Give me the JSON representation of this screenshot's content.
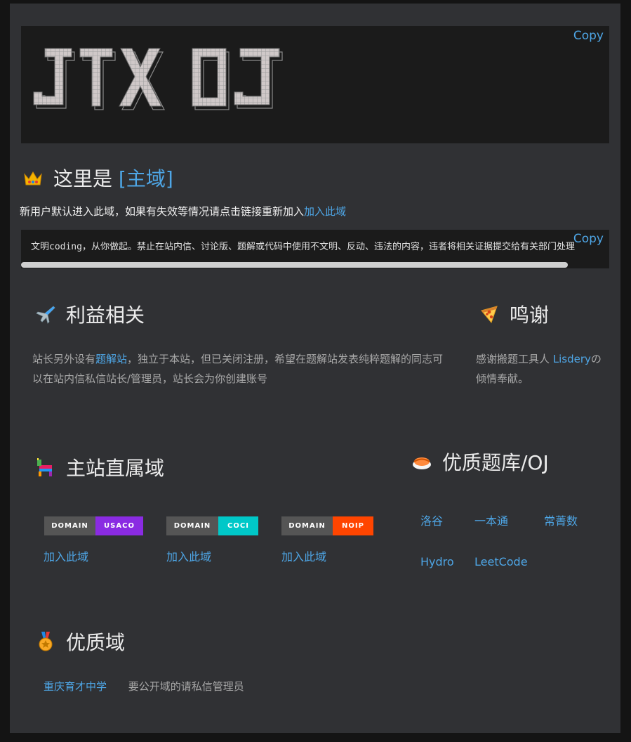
{
  "banner": {
    "copy_label": "Copy",
    "ascii_text": "JTX OJ"
  },
  "main_domain": {
    "prefix": "这里是 ",
    "domain": "[主域]",
    "intro": "新用户默认进入此域，如果有失效等情况请点击链接重新加入",
    "join_link": "加入此域"
  },
  "notice": {
    "copy_label": "Copy",
    "text": "文明coding，从你做起。禁止在站内信、讨论版、题解或代码中使用不文明、反动、违法的内容，违者将相关证据提交给有关部门处理"
  },
  "interest": {
    "title": "利益相关",
    "text_before": "站长另外设有",
    "link": "题解站",
    "text_after": "，独立于本站，但已关闭注册，希望在题解站发表纯粹题解的同志可以在站内信私信站长/管理员，站长会为你创建账号"
  },
  "thanks": {
    "title": "鸣谢",
    "text_before": "感谢搬题工具人 ",
    "link": "Lisdery",
    "text_after": "の倾情奉献。"
  },
  "sub_domains": {
    "title": "主站直属域",
    "badges": [
      {
        "left": "DOMAIN",
        "right": "USACO",
        "color": "#8a2be2",
        "join": "加入此域"
      },
      {
        "left": "DOMAIN",
        "right": "COCI",
        "color": "#00c8c8",
        "join": "加入此域"
      },
      {
        "left": "DOMAIN",
        "right": "NOIP",
        "color": "#ff4500",
        "join": "加入此域"
      }
    ]
  },
  "oj_list": {
    "title": "优质题库/OJ",
    "items": [
      "洛谷",
      "一本通",
      "常菁数",
      "Hydro",
      "LeetCode"
    ]
  },
  "quality": {
    "title": "优质域",
    "link": "重庆育才中学",
    "note": "要公开域的请私信管理员"
  }
}
